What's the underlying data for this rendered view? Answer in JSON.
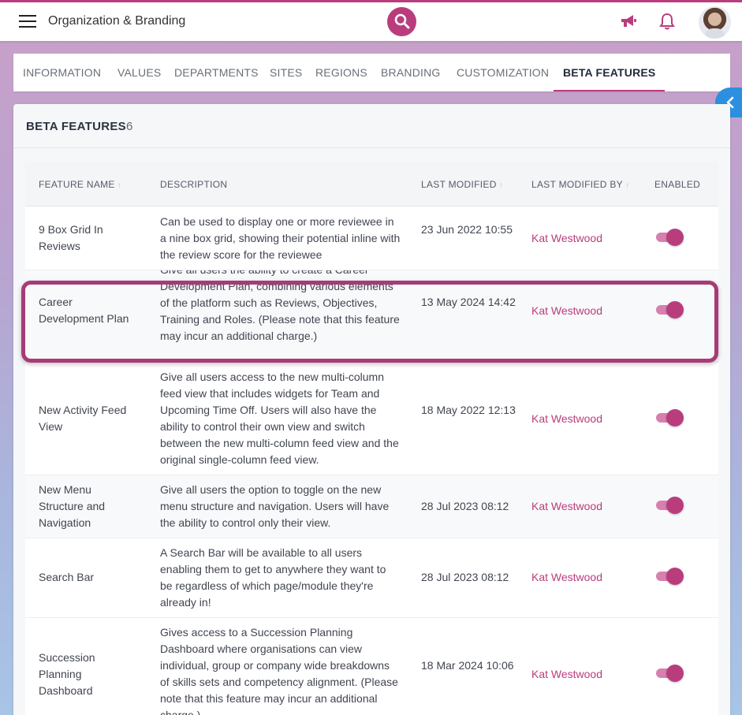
{
  "header": {
    "title": "Organization & Branding",
    "icons": {
      "menu": "menu-icon",
      "search": "search-icon",
      "announcements": "megaphone-icon",
      "notifications": "bell-icon",
      "avatar": "user-avatar"
    }
  },
  "tabs": [
    {
      "label": "INFORMATION",
      "active": false
    },
    {
      "label": "VALUES",
      "active": false
    },
    {
      "label": "DEPARTMENTS",
      "active": false
    },
    {
      "label": "SITES",
      "active": false
    },
    {
      "label": "REGIONS",
      "active": false
    },
    {
      "label": "BRANDING",
      "active": false
    },
    {
      "label": "CUSTOMIZATION",
      "active": false
    },
    {
      "label": "BETA FEATURES",
      "active": true
    }
  ],
  "panel": {
    "title": "BETA FEATURES",
    "count": "6"
  },
  "table": {
    "columns": {
      "name": "FEATURE NAME",
      "description": "DESCRIPTION",
      "last_modified": "LAST MODIFIED",
      "last_modified_by": "LAST MODIFIED BY",
      "enabled": "ENABLED"
    },
    "rows": [
      {
        "name": "9 Box Grid In Reviews",
        "description": "Can be used to display one or more reviewee in a nine box grid, showing their potential inline with the review score for the reviewee",
        "last_modified": "23 Jun 2022 10:55",
        "last_modified_by": "Kat Westwood",
        "enabled": true
      },
      {
        "name": "Career Development Plan",
        "description": "Give all users the ability to create a Career Development Plan, combining various elements of the platform such as Reviews, Objectives, Training and Roles. (Please note that this feature may incur an additional charge.)",
        "last_modified": "13 May 2024 14:42",
        "last_modified_by": "Kat Westwood",
        "enabled": true
      },
      {
        "name": "New Activity Feed View",
        "description": "Give all users access to the new multi-column feed view that includes widgets for Team and Upcoming Time Off. Users will also have the ability to control their own view and switch between the new multi-column feed view and the original single-column feed view.",
        "last_modified": "18 May 2022 12:13",
        "last_modified_by": "Kat Westwood",
        "enabled": true
      },
      {
        "name": "New Menu Structure and Navigation",
        "description": "Give all users the option to toggle on the new menu structure and navigation. Users will have the ability to control only their view.",
        "last_modified": "28 Jul 2023 08:12",
        "last_modified_by": "Kat Westwood",
        "enabled": true
      },
      {
        "name": "Search Bar",
        "description": "A Search Bar will be available to all users enabling them to get to anywhere they want to be regardless of which page/module they're already in!",
        "last_modified": "28 Jul 2023 08:12",
        "last_modified_by": "Kat Westwood",
        "enabled": true
      },
      {
        "name": "Succession Planning Dashboard",
        "description": "Gives access to a Succession Planning Dashboard where organisations can view individual, group or company wide breakdowns of skills sets and competency alignment. (Please note that this feature may incur an additional charge.)",
        "last_modified": "18 Mar 2024 10:06",
        "last_modified_by": "Kat Westwood",
        "enabled": true
      }
    ]
  },
  "colors": {
    "accent": "#b93d7d",
    "toggle_track": "#d77fae",
    "collapse_button": "#2d8fe0",
    "highlight_border": "#a83a78"
  }
}
